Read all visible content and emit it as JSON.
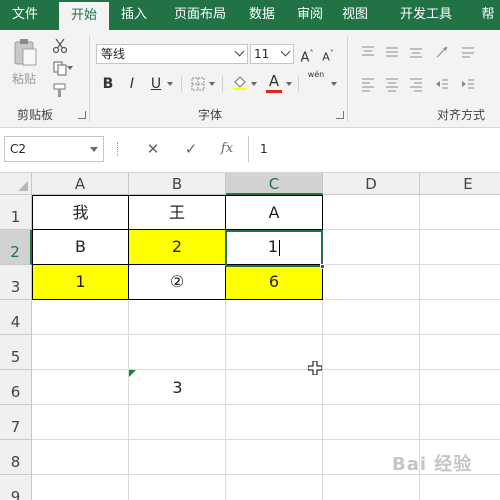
{
  "ribbon": {
    "tabs": [
      {
        "label": "文件",
        "active": false
      },
      {
        "label": "开始",
        "active": true
      },
      {
        "label": "插入",
        "active": false
      },
      {
        "label": "页面布局",
        "active": false
      },
      {
        "label": "数据",
        "active": false
      },
      {
        "label": "审阅",
        "active": false
      },
      {
        "label": "视图",
        "active": false
      },
      {
        "label": "开发工具",
        "active": false
      },
      {
        "label": "帮",
        "active": false
      }
    ],
    "clipboard": {
      "paste_label": "粘贴",
      "group_label": "剪贴板"
    },
    "font": {
      "name": "等线",
      "size": "11",
      "bold": "B",
      "italic": "I",
      "underline": "U",
      "font_color_letter": "A",
      "grow_letter": "A",
      "shrink_letter": "A",
      "phonetic_letters": "wén",
      "group_label": "字体",
      "accent_color": "#e2231a"
    },
    "alignment": {
      "group_label": "对齐方式"
    }
  },
  "formula_bar": {
    "name_box": "C2",
    "cancel_icon": "✕",
    "enter_icon": "✓",
    "fx_label": "fx",
    "value": "1"
  },
  "grid": {
    "columns": [
      "A",
      "B",
      "C",
      "D",
      "E"
    ],
    "selected_column": "C",
    "rows": [
      "1",
      "2",
      "3",
      "4",
      "5",
      "6",
      "7",
      "8",
      "9"
    ],
    "selected_row": "2",
    "cells": {
      "A1": "我",
      "B1": "王",
      "C1": "A",
      "A2": "B",
      "B2": "2",
      "C2": "1",
      "A3": "1",
      "B3": "②",
      "C3": "6",
      "B6": "3"
    },
    "highlight_color": "#ffff00",
    "accent_color": "#217346"
  },
  "watermark": "Bai 经验"
}
